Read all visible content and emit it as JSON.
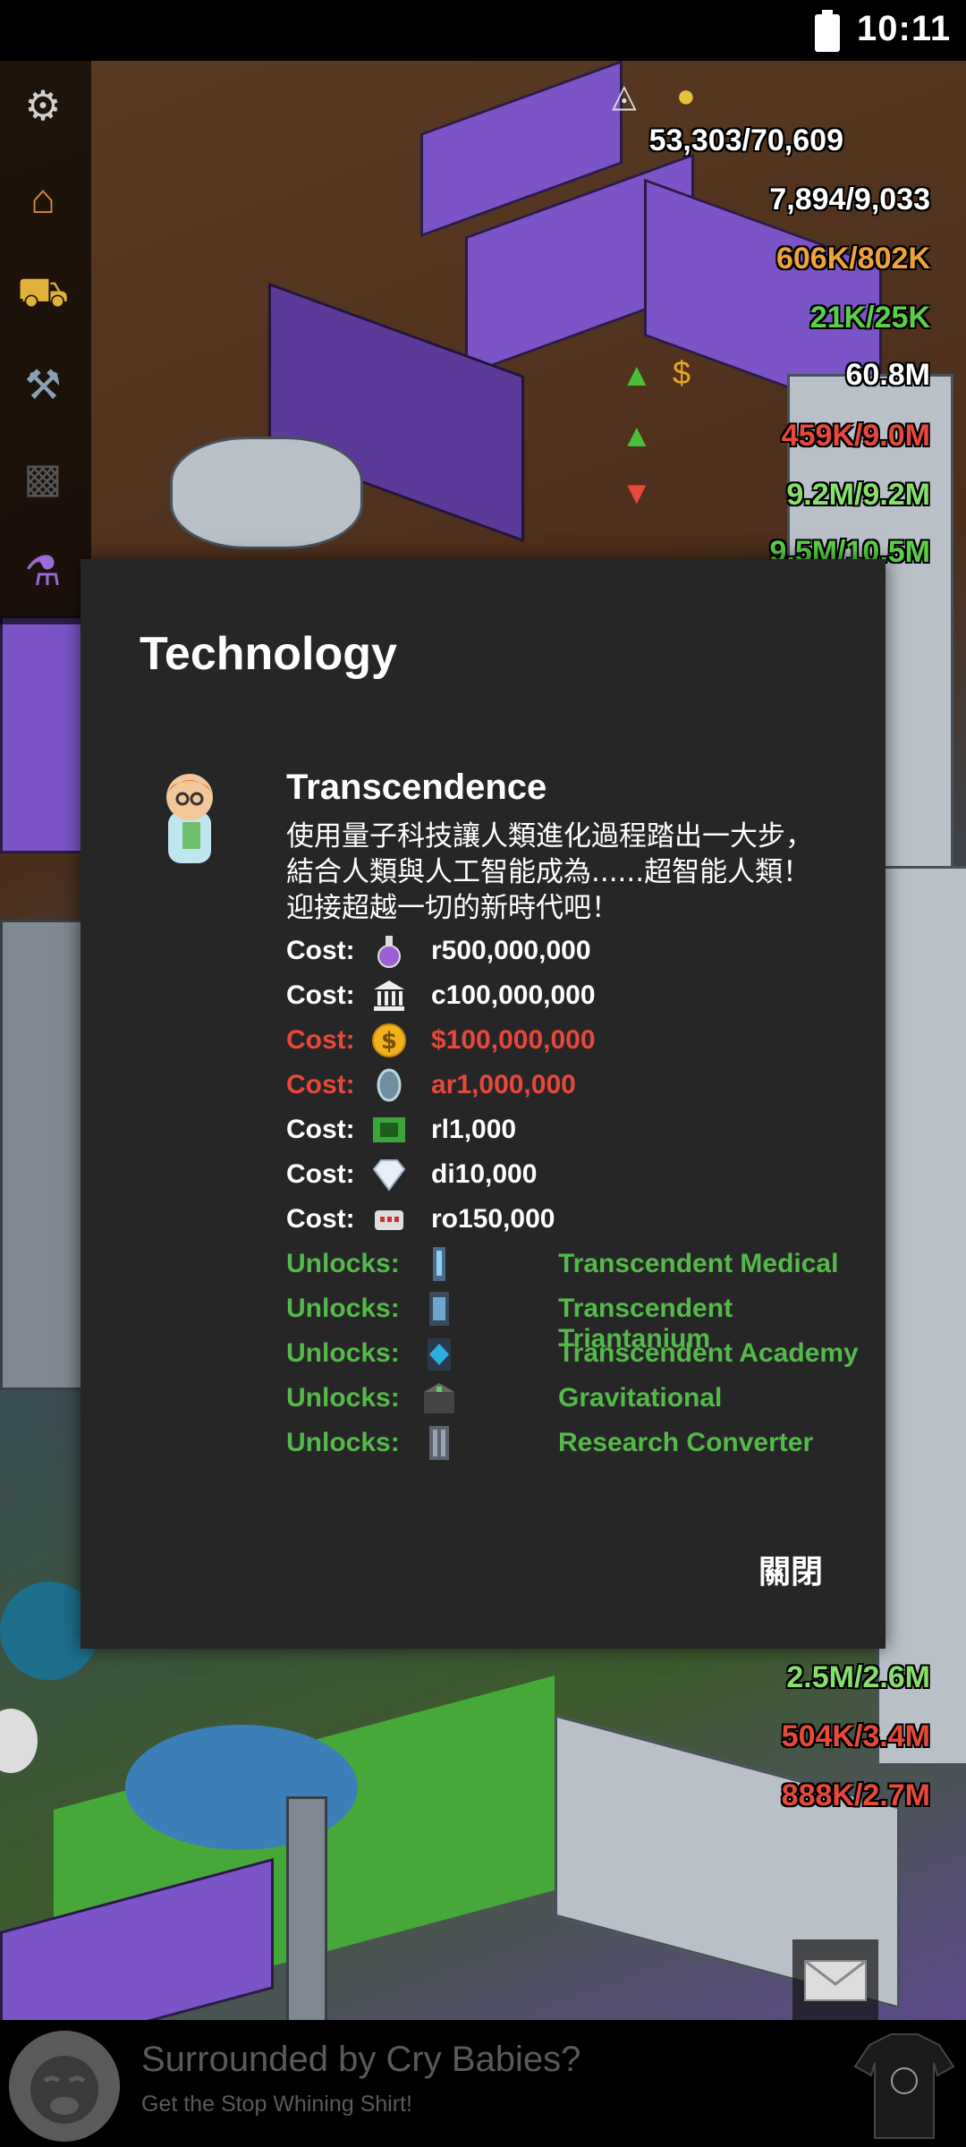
{
  "status_bar": {
    "time": "10:11"
  },
  "hud": {
    "population": "53,303/70,609",
    "workers": "7,894/9,033",
    "rows": [
      "606K/802K",
      "21K/25K",
      "60.8M",
      "459K/9.0M",
      "9.2M/9.2M",
      "9.5M/10.5M"
    ],
    "bottom_rows": [
      "2.5M/2.6M",
      "504K/3.4M",
      "888K/2.7M"
    ]
  },
  "dialog": {
    "title": "Technology",
    "tech_name": "Transcendence",
    "tech_description": "使用量子科技讓人類進化過程踏出一大步，結合人類與人工智能成為......超智能人類！迎接超越一切的新時代吧！",
    "costs": [
      {
        "label": "Cost:",
        "icon": "research-flask-icon",
        "value": "r500,000,000",
        "insufficient": false
      },
      {
        "label": "Cost:",
        "icon": "culture-building-icon",
        "value": "c100,000,000",
        "insufficient": false
      },
      {
        "label": "Cost:",
        "icon": "money-coin-icon",
        "value": "$100,000,000",
        "insufficient": true
      },
      {
        "label": "Cost:",
        "icon": "artifact-icon",
        "value": "ar1,000,000",
        "insufficient": true
      },
      {
        "label": "Cost:",
        "icon": "circuit-icon",
        "value": "rl1,000",
        "insufficient": false
      },
      {
        "label": "Cost:",
        "icon": "diamond-icon",
        "value": "di10,000",
        "insufficient": false
      },
      {
        "label": "Cost:",
        "icon": "robot-icon",
        "value": "ro150,000",
        "insufficient": false
      }
    ],
    "unlocks": [
      {
        "label": "Unlocks:",
        "icon": "tower-building-icon",
        "value": "Transcendent Medical"
      },
      {
        "label": "Unlocks:",
        "icon": "tower-building-icon",
        "value": "Transcendent Triantanium"
      },
      {
        "label": "Unlocks:",
        "icon": "tower-building-icon",
        "value": "Transcendent Academy"
      },
      {
        "label": "Unlocks:",
        "icon": "tower-building-icon",
        "value": "Gravitational"
      },
      {
        "label": "Unlocks:",
        "icon": "tower-building-icon",
        "value": "Research Converter"
      }
    ],
    "close_label": "關閉"
  },
  "ad": {
    "title": "Surrounded by Cry Babies?",
    "subtitle": "Get the Stop Whining Shirt!"
  },
  "colors": {
    "dialog_bg": "#262626",
    "insufficient": "#e8473b",
    "unlock": "#54b94a"
  }
}
